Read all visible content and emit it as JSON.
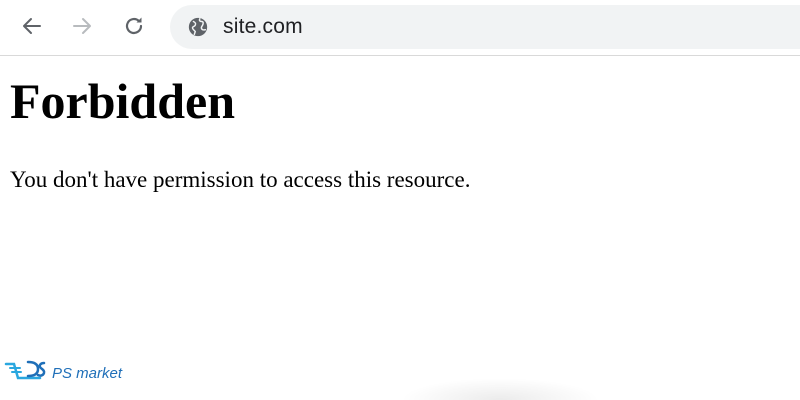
{
  "browser": {
    "url": "site.com",
    "back_icon": "arrow-left-icon",
    "forward_icon": "arrow-right-icon",
    "reload_icon": "reload-icon",
    "site_info_icon": "globe-icon"
  },
  "page": {
    "heading": "Forbidden",
    "message": "You don't have permission to access this resource."
  },
  "watermark": {
    "logo_text": "PS market",
    "accent_color": "#1f6fb8"
  }
}
